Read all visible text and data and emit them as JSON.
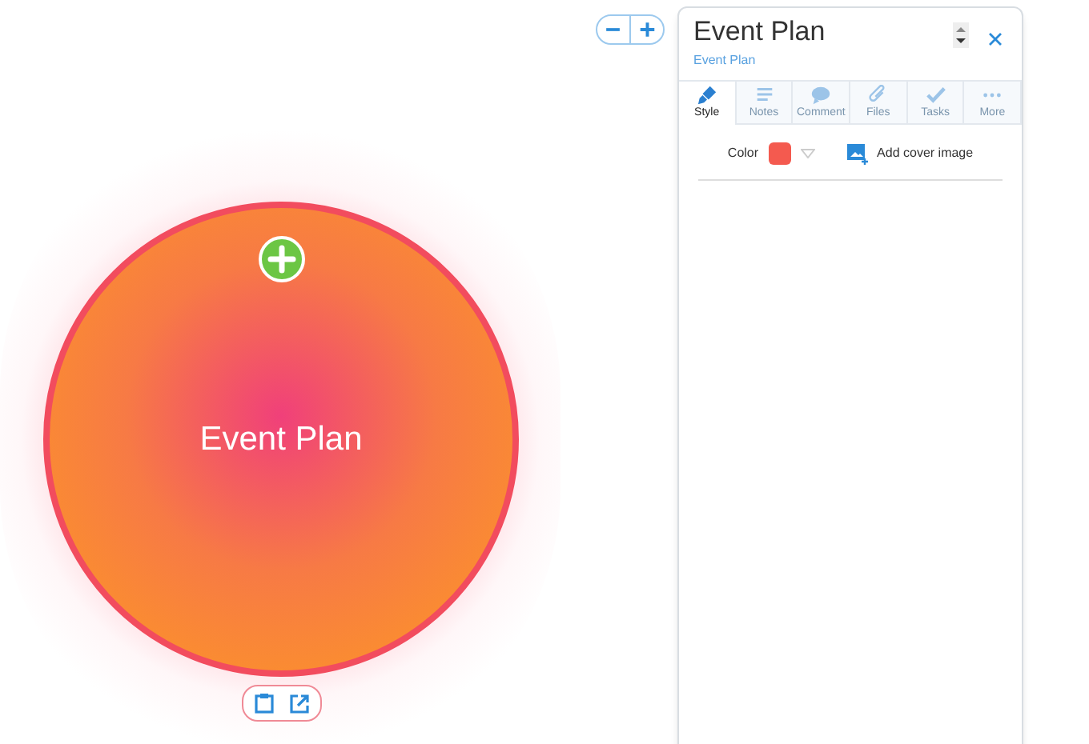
{
  "node": {
    "label": "Event Plan"
  },
  "panel": {
    "title": "Event Plan",
    "breadcrumb": "Event Plan",
    "tabs": [
      {
        "kind": "style",
        "label": "Style",
        "selected": true
      },
      {
        "kind": "notes",
        "label": "Notes",
        "selected": false
      },
      {
        "kind": "comment",
        "label": "Comment",
        "selected": false
      },
      {
        "kind": "files",
        "label": "Files",
        "selected": false
      },
      {
        "kind": "tasks",
        "label": "Tasks",
        "selected": false
      },
      {
        "kind": "more",
        "label": "More",
        "selected": false
      }
    ],
    "color_label": "Color",
    "cover_label": "Add cover image"
  }
}
